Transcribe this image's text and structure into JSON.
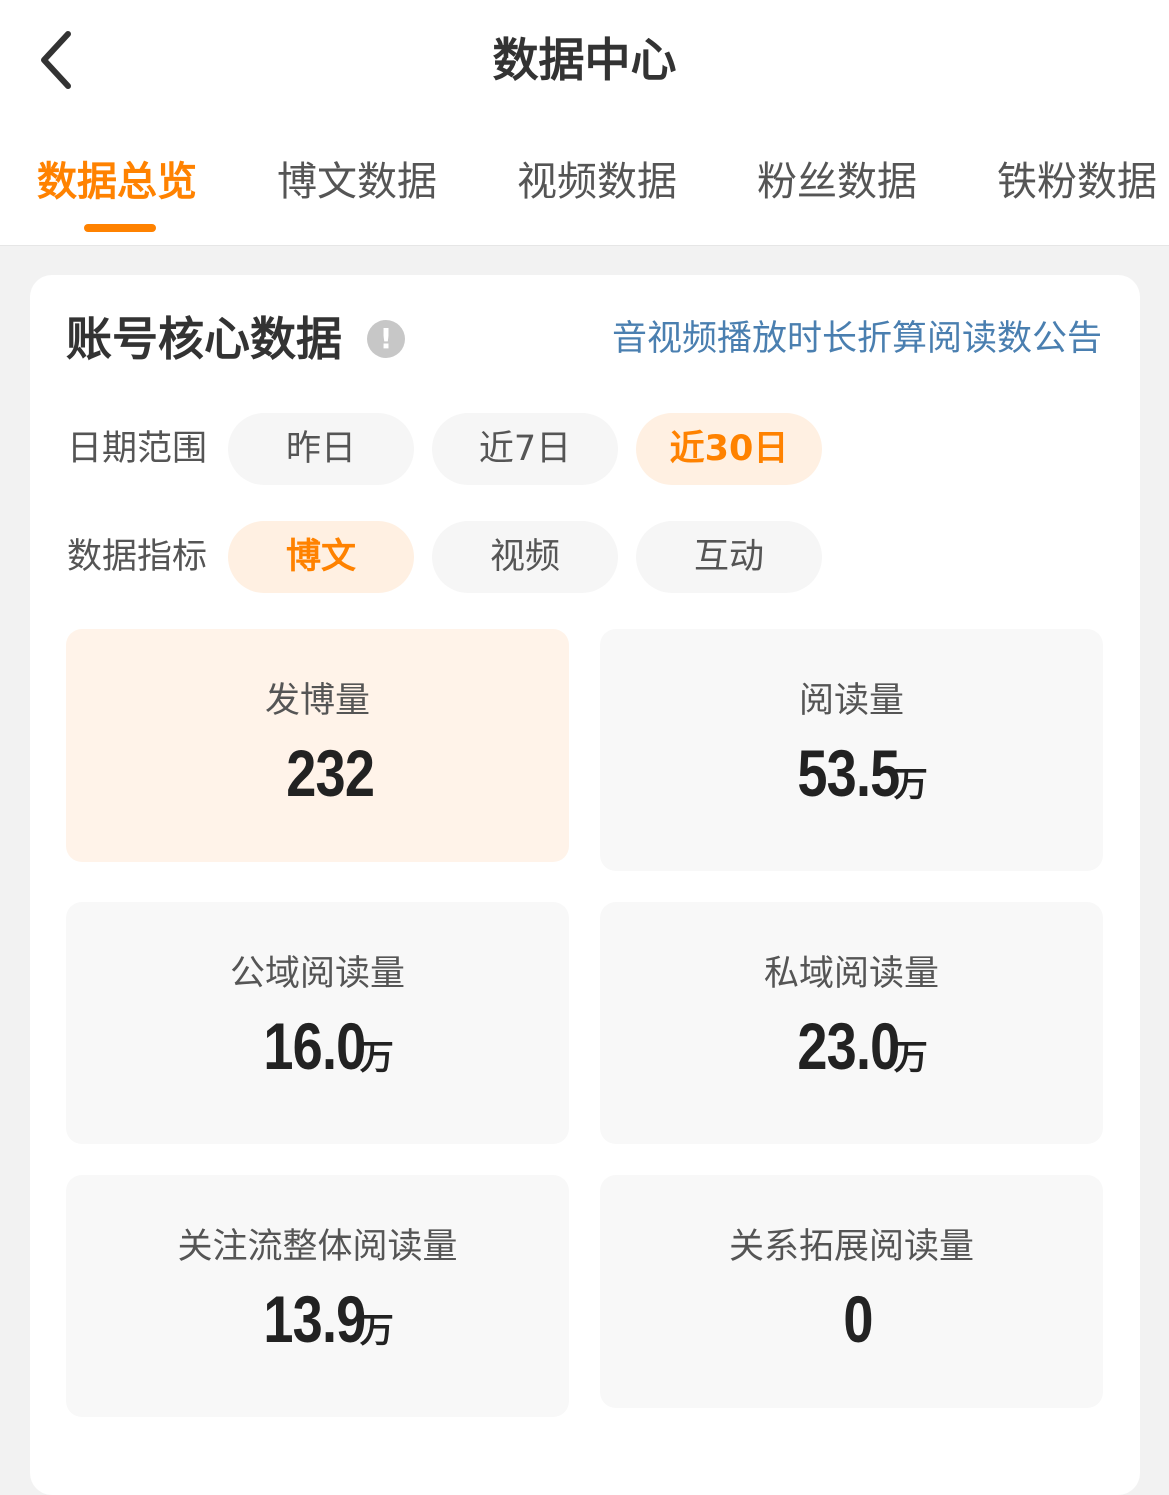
{
  "header": {
    "title": "数据中心"
  },
  "tabs": [
    {
      "label": "数据总览",
      "active": true
    },
    {
      "label": "博文数据",
      "active": false
    },
    {
      "label": "视频数据",
      "active": false
    },
    {
      "label": "粉丝数据",
      "active": false
    },
    {
      "label": "铁粉数据",
      "active": false
    }
  ],
  "section": {
    "title": "账号核心数据",
    "info_icon": "!",
    "notice_link": "音视频播放时长折算阅读数公告"
  },
  "date_range": {
    "label": "日期范围",
    "options": [
      "昨日",
      "近7日",
      "近30日"
    ],
    "selected": "近30日"
  },
  "metric_type": {
    "label": "数据指标",
    "options": [
      "博文",
      "视频",
      "互动"
    ],
    "selected": "博文"
  },
  "metrics": [
    {
      "label": "发博量",
      "value": "232",
      "unit": ""
    },
    {
      "label": "阅读量",
      "value": "53.5",
      "unit": "万"
    },
    {
      "label": "公域阅读量",
      "value": "16.0",
      "unit": "万"
    },
    {
      "label": "私域阅读量",
      "value": "23.0",
      "unit": "万"
    },
    {
      "label": "关注流整体阅读量",
      "value": "13.9",
      "unit": "万"
    },
    {
      "label": "关系拓展阅读量",
      "value": "0",
      "unit": ""
    }
  ],
  "colors": {
    "accent": "#ff8200",
    "link": "#4a7fb0",
    "highlight_bg": "#fff3e9"
  }
}
